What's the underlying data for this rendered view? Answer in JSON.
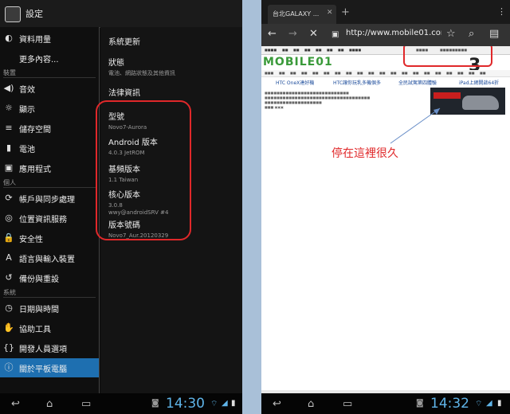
{
  "left": {
    "header_title": "設定",
    "sidebar": {
      "items_top": [
        {
          "label": "資料用量",
          "icon": "data-usage-icon",
          "glyph": "◐"
        },
        {
          "label": "更多內容...",
          "icon": "",
          "glyph": ""
        }
      ],
      "section_device": "裝置",
      "items_device": [
        {
          "label": "音效",
          "icon": "sound-icon",
          "glyph": "◀)"
        },
        {
          "label": "顯示",
          "icon": "display-icon",
          "glyph": "☼"
        },
        {
          "label": "儲存空間",
          "icon": "storage-icon",
          "glyph": "≡"
        },
        {
          "label": "電池",
          "icon": "battery-icon",
          "glyph": "▮"
        },
        {
          "label": "應用程式",
          "icon": "apps-icon",
          "glyph": "▣"
        }
      ],
      "section_personal": "個人",
      "items_personal": [
        {
          "label": "帳戶與同步處理",
          "icon": "sync-icon",
          "glyph": "⟳"
        },
        {
          "label": "位置資訊服務",
          "icon": "location-icon",
          "glyph": "◎"
        },
        {
          "label": "安全性",
          "icon": "lock-icon",
          "glyph": "🔒"
        },
        {
          "label": "語言與輸入裝置",
          "icon": "language-icon",
          "glyph": "A"
        },
        {
          "label": "備份與重設",
          "icon": "backup-icon",
          "glyph": "↺"
        }
      ],
      "section_system": "系統",
      "items_system": [
        {
          "label": "日期與時間",
          "icon": "clock-icon",
          "glyph": "◷"
        },
        {
          "label": "協助工具",
          "icon": "hand-icon",
          "glyph": "✋"
        },
        {
          "label": "開發人員選項",
          "icon": "developer-icon",
          "glyph": "{}"
        },
        {
          "label": "關於平板電腦",
          "icon": "info-icon",
          "glyph": "ⓘ"
        }
      ]
    },
    "detail": [
      {
        "title": "系統更新",
        "sub": ""
      },
      {
        "title": "狀態",
        "sub": "電池、網路狀態及其他資訊"
      },
      {
        "title": "法律資訊",
        "sub": ""
      },
      {
        "title": "型號",
        "sub": "Novo7-Aurora"
      },
      {
        "title": "Android 版本",
        "sub": "4.0.3 JetROM"
      },
      {
        "title": "基頻版本",
        "sub": "1.1 Taiwan"
      },
      {
        "title": "核心版本",
        "sub": "3.0.8\nwwy@androidSRV #4"
      },
      {
        "title": "版本號碼",
        "sub": "Novo7_Aur.20120329"
      }
    ],
    "clock": "14:30"
  },
  "right": {
    "tab_title": "台北GALAXY ...",
    "url": "http://www.mobile01.com/",
    "logo": "MOBILE01",
    "big_number": "3",
    "headlines": [
      "HTC OneX達好機",
      "HTC讓你玩乳多機個多",
      "全民試駕第四體驗",
      "iPad上網開啟64折"
    ],
    "annotation": "停在這裡很久",
    "clock": "14:32"
  },
  "colors": {
    "accent_blue": "#1e6fb0",
    "highlight_red": "#e0282a",
    "clock_blue": "#5fb4e8"
  }
}
